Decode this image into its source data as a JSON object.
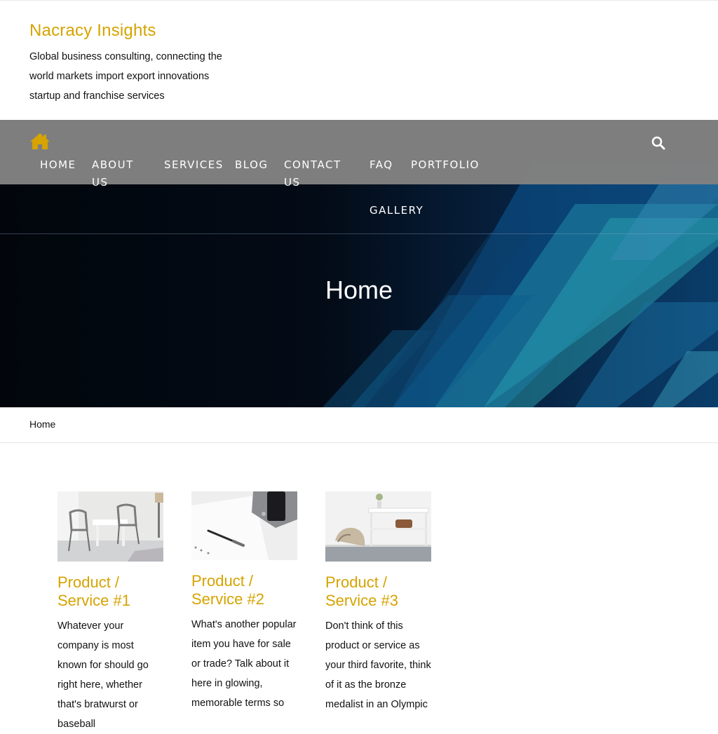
{
  "site": {
    "title": "Nacracy Insights",
    "description": "Global business consulting, connecting the world markets import export innovations startup and franchise services"
  },
  "nav": {
    "items": [
      {
        "label": "HOME"
      },
      {
        "label": "ABOUT US"
      },
      {
        "label": "SERVICES"
      },
      {
        "label": "BLOG"
      },
      {
        "label": "CONTACT US"
      },
      {
        "label": "FAQ"
      },
      {
        "label": "PORTFOLIO"
      },
      {
        "label": "GALLERY"
      }
    ],
    "home_icon": "home-icon",
    "search_icon": "search-icon"
  },
  "hero": {
    "title": "Home"
  },
  "breadcrumb": {
    "current": "Home"
  },
  "products": [
    {
      "title": "Product / Service #1",
      "text": "Whatever your company is most known for should go right here, whether that's bratwurst or baseball"
    },
    {
      "title": "Product / Service #2",
      "text": "What's another popular item you have for sale or trade? Talk about it here in glowing, memorable terms so"
    },
    {
      "title": "Product / Service #3",
      "text": "Don't think of this product or service as your third favorite, think of it as the bronze medalist in an Olympic"
    }
  ],
  "colors": {
    "accent": "#d6a300",
    "nav_bg": "#808080",
    "hero_bg": "#02070e"
  }
}
